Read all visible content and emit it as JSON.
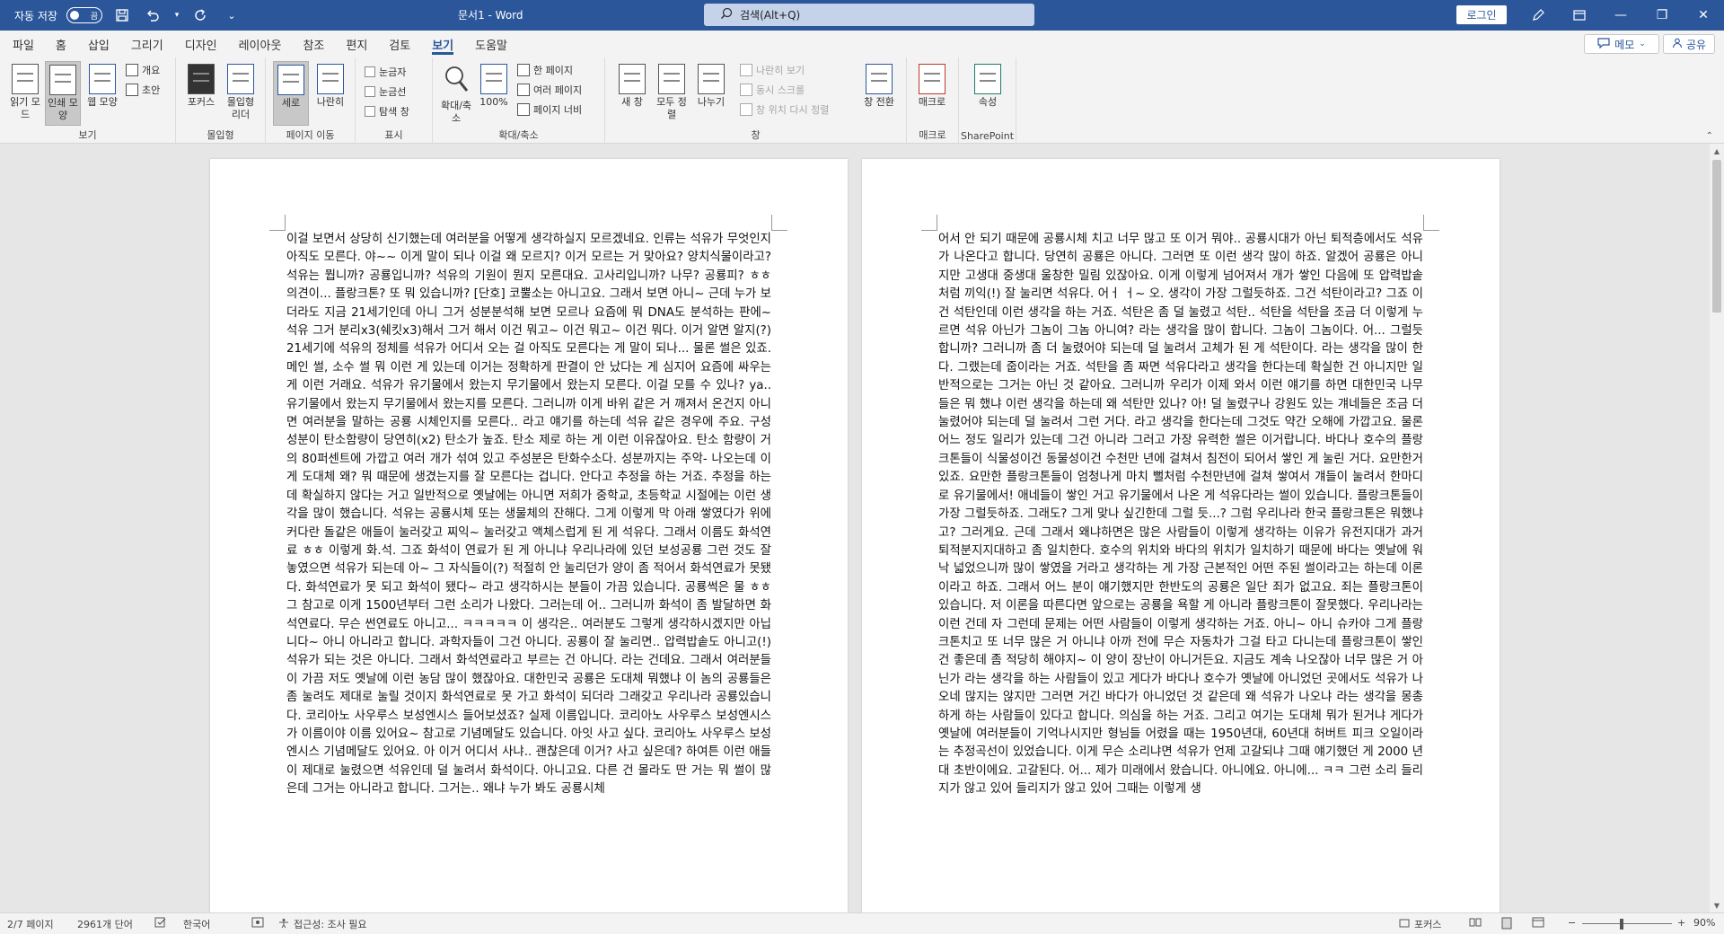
{
  "titlebar": {
    "autosave_label": "자동 저장",
    "autosave_state": "끔",
    "doc_title": "문서1  -  Word",
    "search_placeholder": "검색(Alt+Q)",
    "login_label": "로그인"
  },
  "tabs": [
    "파일",
    "홈",
    "삽입",
    "그리기",
    "디자인",
    "레이아웃",
    "참조",
    "편지",
    "검토",
    "보기",
    "도움말"
  ],
  "active_tab": "보기",
  "memo_label": "메모",
  "share_label": "공유",
  "ribbon": {
    "groups": {
      "view": "보기",
      "immersive": "몰입형",
      "page_move": "페이지 이동",
      "show": "표시",
      "zoom": "확대/축소",
      "window": "창",
      "macro": "매크로",
      "sharepoint": "SharePoint"
    },
    "view": {
      "read_mode": "읽기 모드",
      "print_layout": "인쇄 모양",
      "web_layout": "웹 모양",
      "outline": "개요",
      "draft": "초안"
    },
    "immersive": {
      "focus": "포커스",
      "reader": "몰입형 리더"
    },
    "page_move": {
      "vertical": "세로",
      "side": "나란히"
    },
    "show": {
      "ruler": "눈금자",
      "gridlines": "눈금선",
      "nav_pane": "탐색 창"
    },
    "zoom": {
      "zoom": "확대/축소",
      "hundred": "100%",
      "one_page": "한 페이지",
      "multi_page": "여러 페이지",
      "page_width": "페이지 너비"
    },
    "window": {
      "new_window": "새 창",
      "arrange_all": "모두 정렬",
      "split": "나누기",
      "side_by_side": "나란히 보기",
      "sync_scroll": "동시 스크롤",
      "reset_position": "창 위치 다시 정렬",
      "switch": "창 전환"
    },
    "macro": "매크로",
    "properties": "속성"
  },
  "document": {
    "page1": "이걸 보면서 상당히 신기했는데 여러분을 어떻게 생각하실지 모르겠네요. 인류는 석유가 무엇인지 아직도 모른다. 야~~ 이게 말이 되나 이걸 왜 모르지? 이거 모르는 거 맞아요? 양치식물이라고? 석유는 뭡니까? 공룡입니까? 석유의 기원이 뭔지 모른대요. 고사리입니까? 나무? 공룡피? ㅎㅎ 의견이... 플랑크톤? 또 뭐 있습니까? [단호] 코뿔소는 아니고요. 그래서 보면 아니~ 근데 누가 보더라도 지금 21세기인데 아니 그거 성분분석해 보면 모르나 요즘에 뭐 DNA도 분석하는 판에~ 석유 그거 분리x3(쉐킷x3)해서 그거 해서 이건 뭐고~ 이건 뭐고~ 이건 뭐다. 이거 알면 알지(?) 21세기에 석유의 정체를 석유가 어디서 오는 걸 아직도 모른다는 게 말이 되나... 물론 썰은 있죠. 메인 썰, 소수 썰 뭐 이런 게 있는데 이거는 정확하게 판결이 안 났다는 게 심지어 요즘에 싸우는 게 이런 거래요. 석유가 유기물에서 왔는지 무기물에서 왔는지 모른다. 이걸 모를 수 있나? ya.. 유기물에서 왔는지 무기물에서 왔는지를 모른다. 그러니까 이게 바위 같은 거 깨져서 온건지 아니면 여러분을 말하는 공룡 시체인지를 모른다.. 라고 얘기를 하는데 석유 같은 경우에 주요. 구성 성분이 탄소함량이 당연히(x2) 탄소가 높죠. 탄소 제로 하는 게 이런 이유잖아요. 탄소 함량이 거의 80퍼센트에 가깝고 여러 개가 섞여 있고 주성분은 탄화수소다. 성분까지는 주악- 나오는데 이게 도대체 왜? 뭐 때문에 생겼는지를 잘 모른다는 겁니다. 안다고 추정을 하는 거죠. 추정을 하는데 확실하지 않다는 거고 일반적으로 옛날에는 아니면 저희가 중학교, 초등학교 시절에는 이런 생각을 많이 했습니다. 석유는 공룡시체 또는 생물체의 잔해다. 그게 이렇게 막 아래 쌓였다가 위에 커다란 돌같은 애들이 눌러갖고 찌익~ 눌러갖고 액체스럽게 된 게 석유다. 그래서 이름도 화석연료 ㅎㅎ 이렇게 화.석. 그죠 화석이 연료가 된 게 아니냐 우리나라에 있던 보성공룡 그런 것도 잘 놓였으면 석유가 되는데 아~ 그 자식들이(?) 적절히 안 눌리던가 양이 좀 적어서 화석연료가 못됐다. 화석연료가 못 되고 화석이 됐다~ 라고 생각하시는 분들이 가끔 있습니다. 공룡썩은 물 ㅎㅎ 그 참고로 이게 1500년부터 그런 소리가 나왔다. 그러는데 어.. 그러니까 화석이 좀 발달하면 화석연료다. 무슨 썬연료도 아니고... ㅋㅋㅋㅋㅋ 이 생각은.. 여러분도 그렇게 생각하시겠지만 아닙니다~ 아니 아니라고 합니다. 과학자들이 그건 아니다. 공룡이 잘 눌리면.. 압력밥솥도 아니고(!) 석유가 되는 것은 아니다. 그래서 화석연료라고 부르는 건 아니다. 라는 건데요. 그래서 여러분들이 가끔 저도 옛날에 이런 농담 많이 했잖아요. 대한민국 공룡은 도대체 뭐했냐 이 놈의 공룡들은 좀 눌려도 제대로 눌릴 것이지 화석연료로 못 가고 화석이 되더라 그래갖고 우리나라 공룡있습니다. 코리아노 사우루스 보성엔시스 들어보셨죠? 실제 이름입니다. 코리아노 사우루스 보성엔시스가 이름이야 이름 있어요~ 참고로 기념메달도 있습니다. 아잇 사고 싶다. 코리아노 사우루스 보성엔시스 기념메달도 있어요. 아 이거 어디서 사냐.. 괜찮은데 이거? 사고 싶은데? 하여튼 이런 애들이 제대로 눌렸으면 석유인데 덜 눌려서 화석이다. 아니고요. 다른 건 몰라도 딴 거는 뭐 썰이 많은데 그거는 아니라고 합니다. 그거는.. 왜냐 누가 봐도 공룡시체",
    "page2": "어서 안 되기 때문에 공룡시체 치고 너무 많고 또 이거 뭐야.. 공룡시대가 아닌 퇴적층에서도 석유가 나온다고 합니다. 당연히 공룡은 아니다. 그러면 또 이런 생각 많이 하죠. 알겠어 공룡은 아니지만 고생대 중생대 울창한 밀림 있잖아요. 이게 이렇게 넘어져서 개가 쌓인 다음에 또 압력밥솥처럼 끼익(!) 잘 눌리면 석유다. 어ㅓ ㅓ~ 오. 생각이 가장 그럴듯하죠. 그건 석탄이라고? 그죠 이건 석탄인데 이런 생각을 하는 거죠. 석탄은 좀 덜 눌렸고 석탄.. 석탄을 석탄을 조금 더 이렇게 누르면 석유 아닌가 그놈이 그놈 아니여? 라는 생각을 많이 합니다. 그놈이 그놈이다. 어... 그럴듯 합니까? 그러니까 좀 더 눌렸어야 되는데 덜 눌려서 고체가 된 게 석탄이다. 라는 생각을 많이 한다. 그랬는데 줍이라는 거죠. 석탄을 좀 짜면 석유다라고 생각을 한다는데 확실한 건 아니지만 일반적으로는 그거는 아닌 것 같아요. 그러니까 우리가 이제 와서 이런 얘기를 하면 대한민국 나무들은 뭐 했냐 이런 생각을 하는데 왜 석탄만 있나? 아! 덜 눌렸구나 강원도 있는 걔네들은 조금 더 눌렸어야 되는데 덜 눌려서 그런 거다. 라고 생각을 한다는데 그것도 약간 오해에 가깝고요. 물론 어느 정도 일리가 있는데 그건 아니라 그러고 가장 유력한 썰은 이거랍니다. 바다나 호수의 플랑크톤들이 식물성이건 동물성이건 수천만 년에 걸쳐서 침전이 되어서 쌓인 게 눌린 거다. 요만한거 있죠. 요만한 플랑크톤들이 엄청나게 마치 뻘처럼 수천만년에 걸쳐 쌓여서 걔들이 눌려서 한마디로 유기물에서! 애네들이 쌓인 거고 유기물에서 나온 게 석유다라는 썰이 있습니다. 플랑크톤들이 가장 그럴듯하죠. 그래도? 그게 맞나 싶긴한데 그럴 듯...? 그럼 우리나라 한국 플랑크톤은 뭐했냐고? 그러게요. 근데 그래서 왜냐하면은 많은 사람들이 이렇게 생각하는 이유가 유전지대가 과거 퇴적분지지대하고 좀 일치한다. 호수의 위치와 바다의 위치가 일치하기 때문에 바다는 옛날에 워낙 넓었으니까 많이 쌓였을 거라고 생각하는 게 가장 근본적인 어떤 주된 썰이라고는 하는데 이론이라고 하죠. 그래서 어느 분이 얘기했지만 한반도의 공룡은 일단 죄가 없고요. 죄는 플랑크톤이 있습니다. 저 이론을 따른다면 앞으로는 공룡을 욕할 게 아니라 플랑크톤이 잘못했다. 우리나라는 이런 건데 자 그런데 문제는 어떤 사람들이 이렇게 생각하는 거죠. 아니~ 아니 슈카야 그게 플랑크톤치고 또 너무 많은 거 아니냐 아까 전에 무슨 자동차가 그걸 타고 다니는데 플랑크톤이 쌓인 건 좋은데 좀 적당히 해야지~ 이 양이 장난이 아니거든요. 지금도 계속 나오잖아 너무 많은 거 아닌가 라는 생각을 하는 사람들이 있고 게다가 바다나 호수가 옛날에 아니었던 곳에서도 석유가 나오네 많지는 않지만 그러면 거긴 바다가 아니었던 것 같은데 왜 석유가 나오냐 라는 생각을 몽총하게 하는 사람들이 있다고 합니다. 의심을 하는 거죠. 그리고 여기는 도대체 뭐가 된거냐 게다가 옛날에 여러분들이 기억나시지만 형님들 어렸을 때는 1950년대, 60년대 허버트 피크 오일이라는 추정곡선이 있었습니다. 이게 무슨 소리냐면 석유가 언제 고갈되냐 그때 얘기했던 게 2000 년대 초반이에요. 고갈된다. 어... 제가 미래에서 왔습니다. 아니에요. 아니에... ㅋㅋ 그런 소리 들리지가 않고 있어 들리지가 않고 있어 그때는 이렇게 생"
  },
  "status": {
    "page": "2/7 페이지",
    "words": "2961개 단어",
    "language": "한국어",
    "accessibility": "접근성: 조사 필요",
    "focus": "포커스",
    "zoom": "90%"
  },
  "icons": {
    "save": "save-icon",
    "undo": "undo-icon",
    "redo": "redo-icon",
    "search": "search-icon",
    "pen": "pen-icon",
    "ribbon_display": "ribbon-display-icon"
  },
  "colors": {
    "title_blue": "#2b579a",
    "ribbon_bg": "#f3f3f3",
    "canvas_bg": "#e6e6e6"
  }
}
